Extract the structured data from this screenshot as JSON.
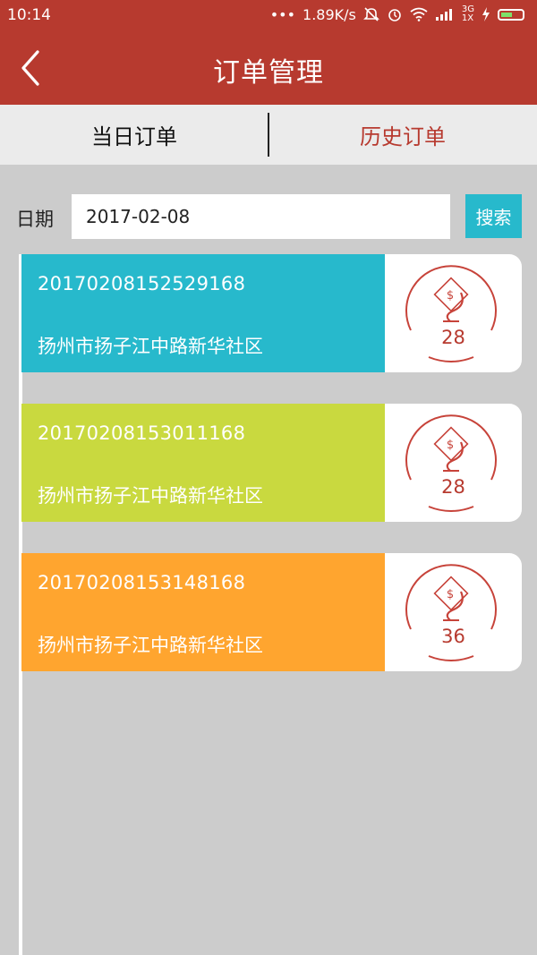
{
  "status_bar": {
    "time": "10:14",
    "dots": "•••",
    "network_speed": "1.89K/s",
    "signal_3g": "3G",
    "signal_1x": "1X"
  },
  "header": {
    "title": "订单管理"
  },
  "tabs": [
    {
      "label": "当日订单",
      "active": true
    },
    {
      "label": "历史订单",
      "active": false
    }
  ],
  "search": {
    "date_label": "日期",
    "date_value": "2017-02-08",
    "button_label": "搜索"
  },
  "colors": {
    "brand_red": "#b73a2f",
    "teal": "#27b9cc",
    "lime": "#c9d93f",
    "orange": "#ffa52f"
  },
  "orders": [
    {
      "id": "20170208152529168",
      "address": "扬州市扬子江中路新华社区",
      "count": "28",
      "color": "#27b9cc",
      "icon": "order-badge-icon"
    },
    {
      "id": "20170208153011168",
      "address": "扬州市扬子江中路新华社区",
      "count": "28",
      "color": "#c9d93f",
      "icon": "order-badge-icon"
    },
    {
      "id": "20170208153148168",
      "address": "扬州市扬子江中路新华社区",
      "count": "36",
      "color": "#ffa52f",
      "icon": "order-badge-icon"
    }
  ]
}
